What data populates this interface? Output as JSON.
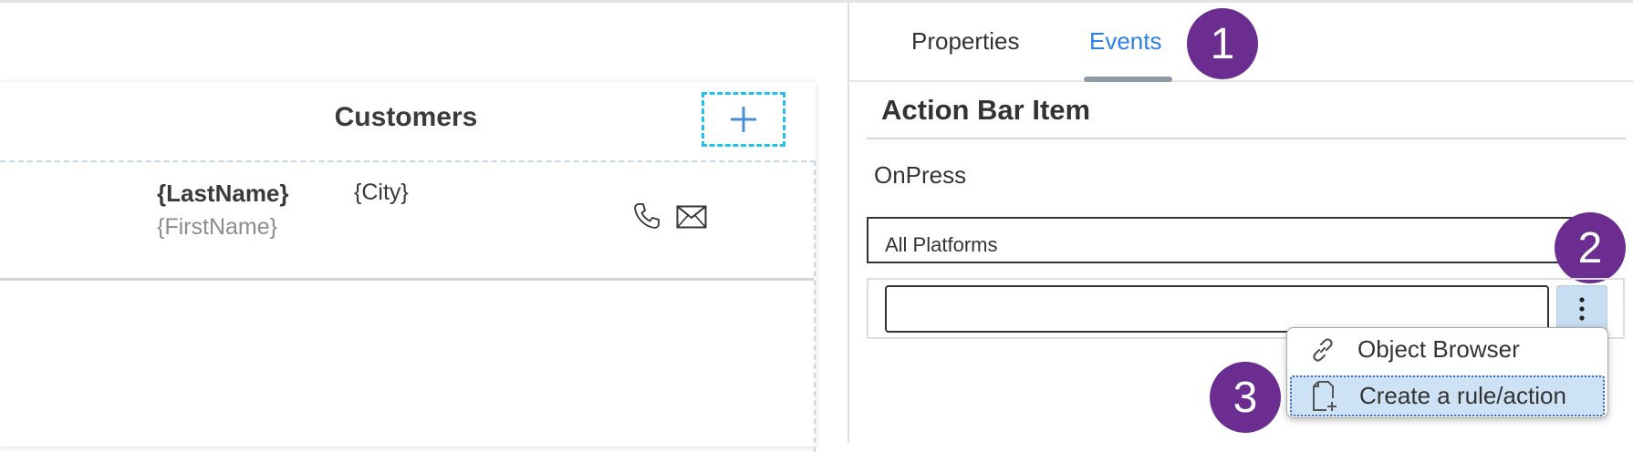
{
  "canvas": {
    "card_title": "Customers",
    "add_icon": "plus-icon",
    "list_row": {
      "last_name": "{LastName}",
      "first_name": "{FirstName}",
      "city": "{City}",
      "phone_icon": "phone-icon",
      "mail_icon": "mail-icon"
    }
  },
  "panel": {
    "tabs": [
      {
        "label": "Properties",
        "active": false
      },
      {
        "label": "Events",
        "active": true
      }
    ],
    "section_title": "Action Bar Item",
    "event_name": "OnPress",
    "platform_select": "All Platforms",
    "action_value": "",
    "more_button_icon": "kebab-icon",
    "context_menu": {
      "items": [
        {
          "label": "Object Browser",
          "icon": "link-icon",
          "selected": false
        },
        {
          "label": "Create a rule/action",
          "icon": "new-file-icon",
          "selected": true
        }
      ]
    }
  },
  "callouts": [
    "1",
    "2",
    "3"
  ],
  "colors": {
    "accent_tab": "#2f80e4",
    "callout_badge": "#6b2d8f",
    "add_button_border": "#22c3ea",
    "menu_selection": "#cde2f5"
  }
}
